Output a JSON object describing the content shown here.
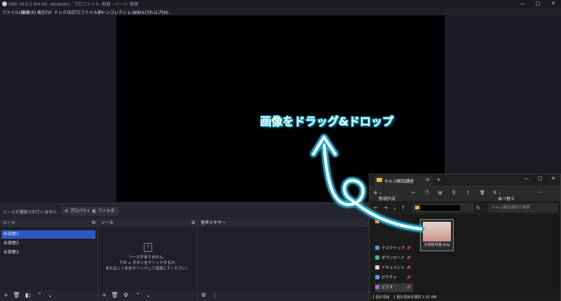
{
  "window": {
    "title": "OBS 29.0.2 (64-bit, windows) - プロファイル: 無題 - シーン: 無題",
    "controls": [
      "—",
      "□",
      "✕"
    ]
  },
  "menu": [
    "ファイル(F)",
    "編集(E)",
    "表示(V)",
    "ドック(D)",
    "プロファイル(P)",
    "シーンコレクション(S)",
    "ツール(T)",
    "ヘルプ(H)"
  ],
  "source_bar": {
    "no_selection": "ソースが選択されていません",
    "properties": "プロパティ",
    "filters": "フィルタ"
  },
  "scenes": {
    "header": "シーン",
    "items": [
      "お部屋1",
      "お部屋2",
      "お部屋3"
    ],
    "selected_index": 0
  },
  "sources": {
    "header": "ソース",
    "empty_lines": [
      "ソースがありません。",
      "下の + ボタンをクリックするか,",
      "またはここを右クリックして追加してください。"
    ]
  },
  "mixer": {
    "header": "音声ミキサー"
  },
  "annotation": "画像をドラッグ&ドロップ",
  "explorer": {
    "tab_title": "ちゃぶ解説講座",
    "new_label": "新規作成",
    "sort_label": "並べ替え",
    "search_placeholder": "ちゃぶ解説講座の検索",
    "nav": [
      {
        "label": "ホーム",
        "color": "#f0a04b",
        "pinned": false
      },
      {
        "label": "デスクトップ",
        "color": "#4a9be0",
        "pinned": true
      },
      {
        "label": "ダウンロード",
        "color": "#3fbf7f",
        "pinned": true
      },
      {
        "label": "ドキュメント",
        "color": "#cfd6e0",
        "pinned": true
      },
      {
        "label": "ピクチャ",
        "color": "#5aa0e8",
        "pinned": true
      },
      {
        "label": "ビデオ",
        "color": "#9b6be0",
        "pinned": true
      }
    ],
    "selected_nav": 5,
    "file_name": "お部屋背景.png",
    "status": "1 個の項目　1 個の項目を選択  1.91 MB"
  },
  "colors": {
    "accent": "#2d59c6",
    "annotation": "#15a7c8"
  }
}
